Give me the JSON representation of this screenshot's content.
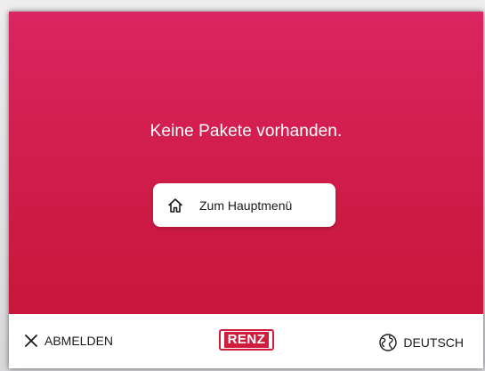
{
  "screen": {
    "message": "Keine Pakete vorhanden.",
    "home_button": {
      "label": "Zum Hauptmenü",
      "icon": "home-icon"
    }
  },
  "footer": {
    "logout": {
      "label": "ABMELDEN",
      "icon": "close-icon"
    },
    "logo": {
      "text": "RENZ"
    },
    "language": {
      "label": "DEUTSCH",
      "icon": "globe-icon"
    }
  },
  "colors": {
    "primary": "#d01c4a",
    "primary_top": "#dc2462",
    "logo_red": "#d01c3c",
    "text_dark": "#1a1a1a",
    "surface": "#ffffff"
  }
}
